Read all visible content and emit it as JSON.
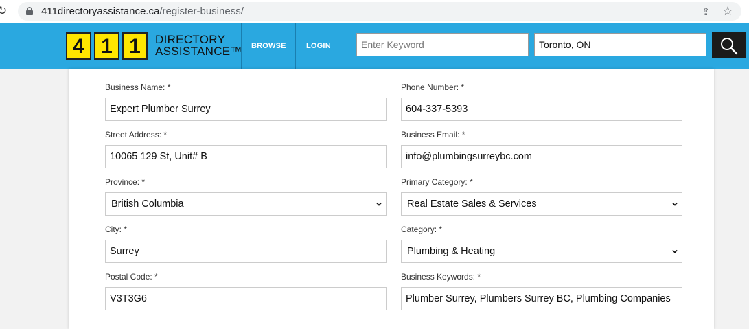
{
  "browser": {
    "url_domain": "411directoryassistance.ca",
    "url_path": "/register-business/"
  },
  "header": {
    "logo_digits": [
      "4",
      "1",
      "1"
    ],
    "logo_line1": "DIRECTORY",
    "logo_line2": "ASSISTANCE™",
    "nav": {
      "browse": "BROWSE",
      "login": "LOGIN"
    },
    "keyword_placeholder": "Enter Keyword",
    "location_value": "Toronto, ON"
  },
  "form": {
    "business_name": {
      "label": "Business Name: *",
      "value": "Expert Plumber Surrey"
    },
    "phone_number": {
      "label": "Phone Number: *",
      "value": "604-337-5393"
    },
    "street_address": {
      "label": "Street Address: *",
      "value": "10065 129 St, Unit# B"
    },
    "business_email": {
      "label": "Business Email: *",
      "value": "info@plumbingsurreybc.com"
    },
    "province": {
      "label": "Province: *",
      "value": "British Columbia"
    },
    "primary_category": {
      "label": "Primary Category: *",
      "value": "Real Estate Sales & Services"
    },
    "city": {
      "label": "City: *",
      "value": "Surrey"
    },
    "category": {
      "label": "Category: *",
      "value": "Plumbing & Heating"
    },
    "postal_code": {
      "label": "Postal Code: *",
      "value": "V3T3G6"
    },
    "business_keywords": {
      "label": "Business Keywords: *",
      "value": "Plumber Surrey, Plumbers Surrey BC, Plumbing Companies"
    }
  }
}
